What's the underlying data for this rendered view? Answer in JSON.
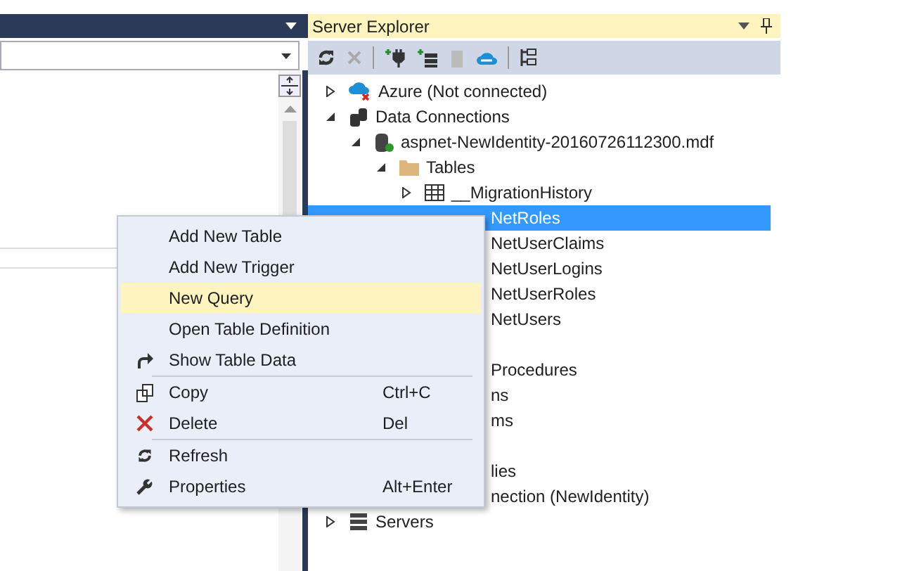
{
  "server_explorer": {
    "title": "Server Explorer",
    "tree": [
      {
        "label": "Azure (Not connected)",
        "kind": "azure",
        "expanded": false,
        "selected": false
      },
      {
        "label": "Data Connections",
        "kind": "connections",
        "expanded": true,
        "selected": false,
        "children": [
          {
            "label": "aspnet-NewIdentity-20160726112300.mdf",
            "kind": "database",
            "expanded": true,
            "selected": false,
            "children": [
              {
                "label": "Tables",
                "kind": "folder",
                "expanded": true,
                "selected": false,
                "children": [
                  {
                    "label": "__MigrationHistory",
                    "kind": "table",
                    "expanded": false,
                    "selected": false
                  },
                  {
                    "label": "NetRoles",
                    "kind": "partial",
                    "selected": true
                  },
                  {
                    "label": "NetUserClaims",
                    "kind": "partial",
                    "selected": false
                  },
                  {
                    "label": "NetUserLogins",
                    "kind": "partial",
                    "selected": false
                  },
                  {
                    "label": "NetUserRoles",
                    "kind": "partial",
                    "selected": false
                  },
                  {
                    "label": "NetUsers",
                    "kind": "partial",
                    "selected": false
                  }
                ]
              },
              {
                "label": "Procedures",
                "kind": "partial",
                "selected": false,
                "gap_before": true
              },
              {
                "label": "ns",
                "kind": "partial",
                "selected": false
              },
              {
                "label": "ms",
                "kind": "partial",
                "selected": false
              },
              {
                "label": "lies",
                "kind": "partial",
                "selected": false,
                "gap_before": true
              }
            ]
          },
          {
            "label": "nection (NewIdentity)",
            "kind": "partial",
            "selected": false
          }
        ]
      },
      {
        "label": "Servers",
        "kind": "servers",
        "expanded": false,
        "selected": false
      }
    ]
  },
  "context_menu": [
    {
      "label": "Add New Table",
      "selected": false
    },
    {
      "label": "Add New Trigger",
      "selected": false
    },
    {
      "label": "New Query",
      "selected": true
    },
    {
      "label": "Open Table Definition",
      "selected": false
    },
    {
      "label": "Show Table Data",
      "kind": "redo",
      "selected": false,
      "separator_after": true
    },
    {
      "label": "Copy",
      "kind": "copy",
      "shortcut": "Ctrl+C",
      "selected": false
    },
    {
      "label": "Delete",
      "kind": "delete",
      "shortcut": "Del",
      "selected": false,
      "separator_after": true
    },
    {
      "label": "Refresh",
      "kind": "refresh",
      "selected": false
    },
    {
      "label": "Properties",
      "kind": "wrench",
      "shortcut": "Alt+Enter",
      "selected": false
    }
  ]
}
